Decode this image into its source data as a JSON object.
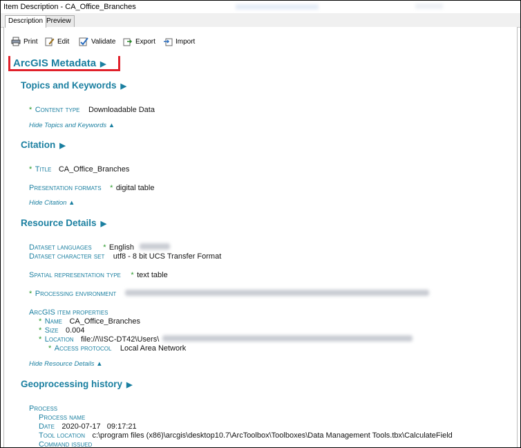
{
  "window": {
    "title": "Item Description - CA_Office_Branches"
  },
  "tabs": [
    {
      "label": "Description",
      "active": true
    },
    {
      "label": "Preview",
      "active": false
    }
  ],
  "toolbar": {
    "print": "Print",
    "edit": "Edit",
    "validate": "Validate",
    "export": "Export",
    "import": "Import"
  },
  "metadata": {
    "title": "ArcGIS Metadata",
    "arrow": "▶",
    "topics": {
      "heading": "Topics and Keywords",
      "content_type_label": "Content type",
      "content_type_value": "Downloadable Data",
      "hide": "Hide Topics and Keywords ▲"
    },
    "citation": {
      "heading": "Citation",
      "title_label": "Title",
      "title_value": "CA_Office_Branches",
      "formats_label": "Presentation formats",
      "formats_value": "digital table",
      "hide": "Hide Citation ▲"
    },
    "resource": {
      "heading": "Resource Details",
      "languages_label": "Dataset languages",
      "languages_value": "English",
      "charset_label": "Dataset character set",
      "charset_value": "utf8 - 8 bit UCS Transfer Format",
      "spatial_label": "Spatial representation type",
      "spatial_value": "text table",
      "env_label": "Processing environment",
      "props_label": "ArcGIS item properties",
      "name_label": "Name",
      "name_value": "CA_Office_Branches",
      "size_label": "Size",
      "size_value": "0.004",
      "location_label": "Location",
      "location_value": "file://\\\\ISC-DT42\\Users\\",
      "protocol_label": "Access protocol",
      "protocol_value": "Local Area Network",
      "hide": "Hide Resource Details ▲"
    },
    "geoprocessing": {
      "heading": "Geoprocessing history",
      "process_label": "Process",
      "process_name_label": "Process name",
      "date_label": "Date",
      "date_value": "2020-07-17   09:17:21",
      "tool_label": "Tool location",
      "tool_value": "c:\\program files (x86)\\arcgis\\desktop10.7\\ArcToolbox\\Toolboxes\\Data Management Tools.tbx\\CalculateField",
      "command_label": "Command issued"
    }
  }
}
